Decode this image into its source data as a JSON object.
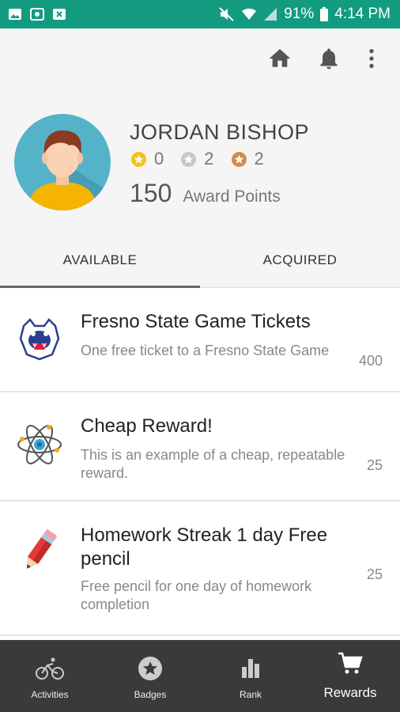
{
  "status": {
    "battery": "91%",
    "time": "4:14 PM"
  },
  "appbar": {
    "home_icon": "home-icon",
    "bell_icon": "bell-icon",
    "more_icon": "more-vert-icon"
  },
  "profile": {
    "name": "JORDAN BISHOP",
    "medals": [
      {
        "color": "#f2c21b",
        "count": "0"
      },
      {
        "color": "#c8c8c8",
        "count": "2"
      },
      {
        "color": "#d98b4a",
        "count": "2"
      }
    ],
    "points": "150",
    "points_label": "Award Points"
  },
  "tabs": [
    {
      "label": "AVAILABLE"
    },
    {
      "label": "ACQUIRED"
    }
  ],
  "rewards": [
    {
      "title": "Fresno State Game Tickets",
      "description": "One free ticket to a Fresno State Game",
      "points": "400",
      "icon": "bulldog-logo-icon"
    },
    {
      "title": "Cheap Reward!",
      "description": "This is an example of a cheap, repeatable reward.",
      "points": "25",
      "icon": "atom-icon"
    },
    {
      "title": "Homework Streak 1 day Free pencil",
      "description": "Free pencil for one day of homework completion",
      "points": "25",
      "icon": "pencil-icon"
    }
  ],
  "nav": [
    {
      "label": "Activities",
      "icon": "bike-icon"
    },
    {
      "label": "Badges",
      "icon": "star-badge-icon"
    },
    {
      "label": "Rank",
      "icon": "bar-chart-icon"
    },
    {
      "label": "Rewards",
      "icon": "cart-icon"
    }
  ],
  "colors": {
    "statusbar": "#139b7f",
    "avatar_bg": "#55b3c9",
    "nav_bg": "#3a3a3a"
  }
}
